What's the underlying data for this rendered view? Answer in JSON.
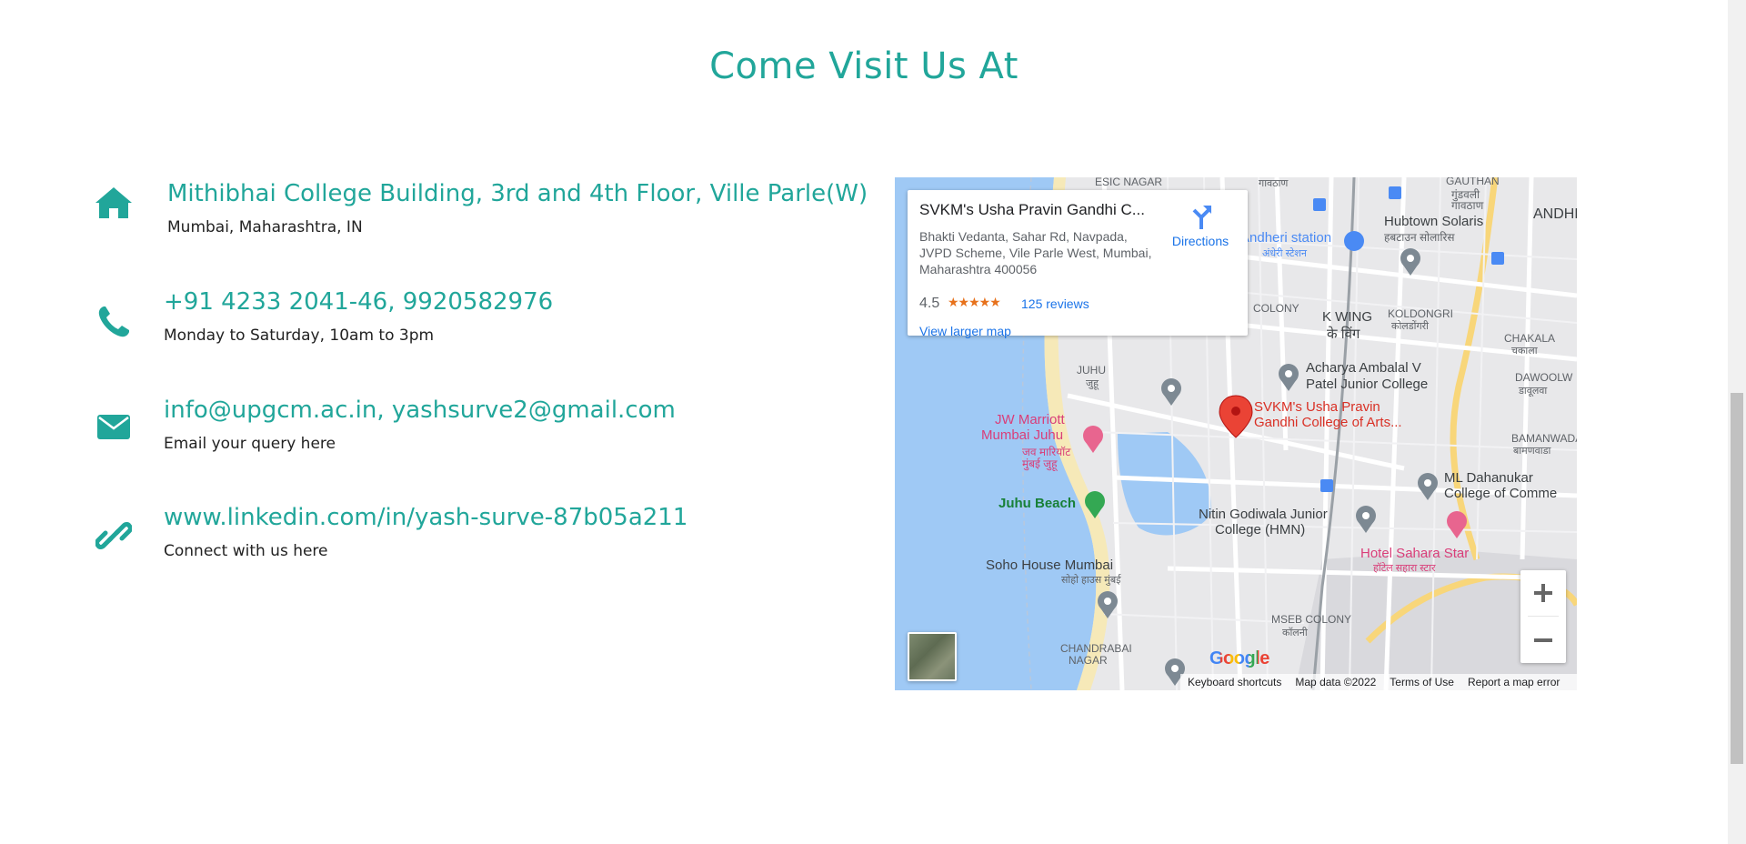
{
  "section_title": "Come Visit Us At",
  "contacts": [
    {
      "heading": "Mithibhai College Building, 3rd and 4th Floor, Ville Parle(W)",
      "sub": "Mumbai, Maharashtra, IN",
      "icon": "home-icon"
    },
    {
      "heading": "+91 4233 2041-46, 9920582976",
      "sub": "Monday to Saturday, 10am to 3pm",
      "icon": "phone-icon"
    },
    {
      "heading": "info@upgcm.ac.in, yashsurve2@gmail.com",
      "sub": "Email your query here",
      "icon": "envelope-icon"
    },
    {
      "heading": "www.linkedin.com/in/yash-surve-87b05a211",
      "sub": "Connect with us here",
      "icon": "link-icon"
    }
  ],
  "colors": {
    "accent": "#21a69a",
    "map_water": "#9fc9f5",
    "marker": "#ea4335"
  },
  "map": {
    "place_name": "SVKM's Usha Pravin Gandhi C...",
    "address": "Bhakti Vedanta, Sahar Rd, Navpada, JVPD Scheme, Vile Parle West, Mumbai, Maharashtra 400056",
    "rating": "4.5",
    "stars": "★★★★★",
    "reviews": "125 reviews",
    "view_larger": "View larger map",
    "directions": "Directions",
    "marker_label_1": "SVKM's Usha Pravin",
    "marker_label_2": "Gandhi College of Arts...",
    "labels": {
      "esic": "ESIC NAGAR",
      "gavthan_top": "गावठाण",
      "gauthan": "GAUTHAN",
      "gundavali": "गुंडवली",
      "gavthan2": "गावठाण",
      "andheri": "ANDHE",
      "andheri_station": "Andheri station",
      "andheri_station_mr": "अंधेरी स्टेशन",
      "hubtown": "Hubtown Solaris",
      "hubtown_mr": "हबटाउन सोलारिस",
      "colony": "COLONY",
      "kwing": "K WING",
      "kwing_mr": "के विंग",
      "koldongri": "KOLDONGRI",
      "koldongri_mr": "कोलडोंगरी",
      "chakala": "CHAKALA",
      "chakala_mr": "चकाला",
      "juhu": "JUHU",
      "juhu_mr": "जुहू",
      "acharya1": "Acharya Ambalal V",
      "acharya2": "Patel Junior College",
      "dawoolw": "DAWOOLW",
      "dawoolw_mr": "डावूलवा",
      "jw1": "JW Marriott",
      "jw2": "Mumbai Juhu",
      "jw3": "जव मारियॉट",
      "jw4": "मुंबई जुहू",
      "bamanwada": "BAMANWADA",
      "bamanwada_mr": "बामणवाडा",
      "juhu_beach": "Juhu Beach",
      "ml1": "ML Dahanukar",
      "ml2": "College of Comme",
      "nitin1": "Nitin Godiwala Junior",
      "nitin2": "College (HMN)",
      "sahara": "Hotel Sahara Star",
      "sahara_mr": "हॉटेल सहारा स्टार",
      "soho": "Soho House Mumbai",
      "soho_mr": "सोहो हाउस मुंबई",
      "mseb": "MSEB COLONY",
      "mseb_mr": "कॉलनी",
      "chandrabai1": "CHANDRABAI",
      "chandrabai2": "NAGAR"
    },
    "google": "Google",
    "attribution": [
      "Keyboard shortcuts",
      "Map data ©2022",
      "Terms of Use",
      "Report a map error"
    ]
  }
}
